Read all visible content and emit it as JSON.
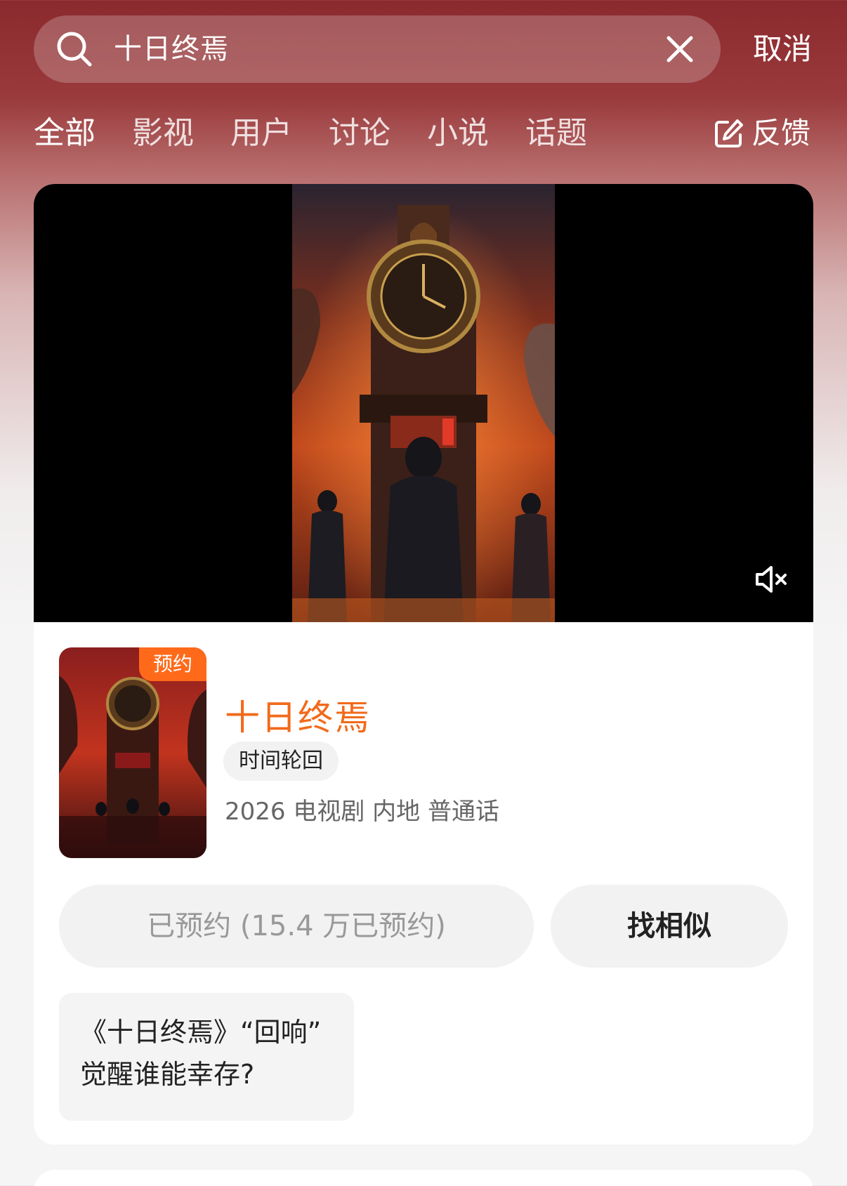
{
  "search": {
    "query": "十日终焉",
    "cancel_label": "取消"
  },
  "tabs": [
    "全部",
    "影视",
    "用户",
    "讨论",
    "小说",
    "话题"
  ],
  "feedback_label": "反馈",
  "result": {
    "badge": "预约",
    "title": "十日终焉",
    "genre_tag": "时间轮回",
    "meta": "2026 电视剧 内地 普通话",
    "reserve_label": "已预约 (15.4 万已预约)",
    "similar_label": "找相似",
    "related": {
      "line1": "《十日终焉》“回响”",
      "line2": "觉醒谁能幸存?"
    }
  },
  "colors": {
    "accent": "#f26a1b",
    "badge": "#ff6a1a",
    "header": "#8a2a2e"
  }
}
